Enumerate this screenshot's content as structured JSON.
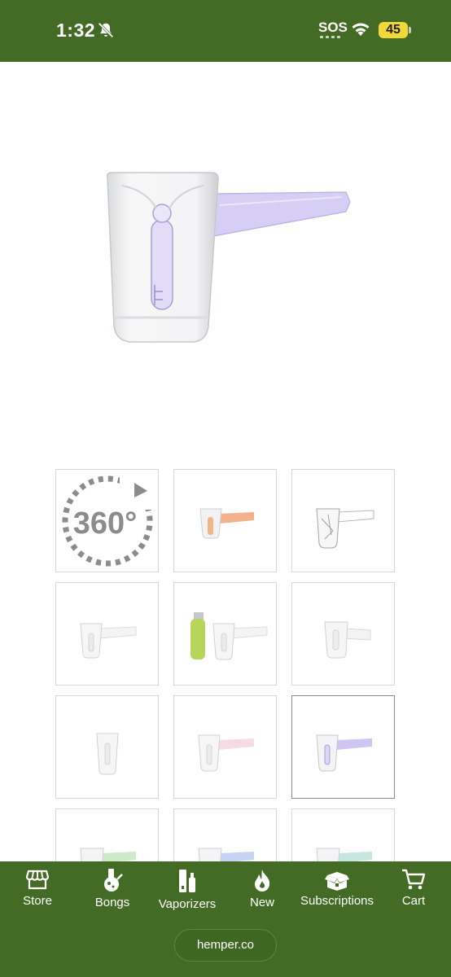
{
  "status_bar": {
    "time": "1:32",
    "sos": "SOS",
    "battery": "45",
    "bg_color": "#446b25",
    "battery_color": "#f3d83a"
  },
  "product": {
    "hero_icon": "glass-hammer-pipe-purple",
    "accent_color": "#b6a8e6"
  },
  "thumbnails": [
    {
      "label": "360°",
      "icon": "rotate-360-icon"
    },
    {
      "icon": "pipe-orange"
    },
    {
      "icon": "pipe-clear-sketch"
    },
    {
      "icon": "pipe-clear"
    },
    {
      "icon": "pipe-with-lighter"
    },
    {
      "icon": "pipe-clear-side"
    },
    {
      "icon": "pipe-clear-front"
    },
    {
      "icon": "pipe-pink"
    },
    {
      "icon": "pipe-purple",
      "selected": true
    },
    {
      "icon": "pipe-green"
    },
    {
      "icon": "pipe-blue"
    },
    {
      "icon": "pipe-teal"
    }
  ],
  "bottom_nav": {
    "items": [
      {
        "label": "Store",
        "icon": "store-icon"
      },
      {
        "label": "Bongs",
        "icon": "bong-icon"
      },
      {
        "label": "Vaporizers",
        "icon": "vaporizer-icon"
      },
      {
        "label": "New",
        "icon": "flame-icon"
      },
      {
        "label": "Subscriptions",
        "icon": "box-icon"
      },
      {
        "label": "Cart",
        "icon": "cart-icon"
      }
    ],
    "url": "hemper.co"
  }
}
